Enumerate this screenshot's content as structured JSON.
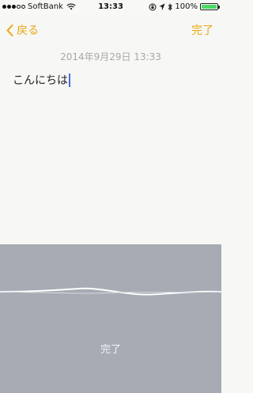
{
  "status_bar": {
    "carrier": "SoftBank",
    "time": "13:33",
    "battery_percent": "100%",
    "signal_strength": 3,
    "battery_level": 1.0,
    "battery_color": "#4cd964"
  },
  "nav": {
    "back_label": "戻る",
    "done_label": "完了",
    "accent_color": "#e9a812"
  },
  "note": {
    "date": "2014年9月29日 13:33",
    "text": "こんにちは"
  },
  "dictation_panel": {
    "done_label": "完了",
    "background": "#a6abb4"
  }
}
